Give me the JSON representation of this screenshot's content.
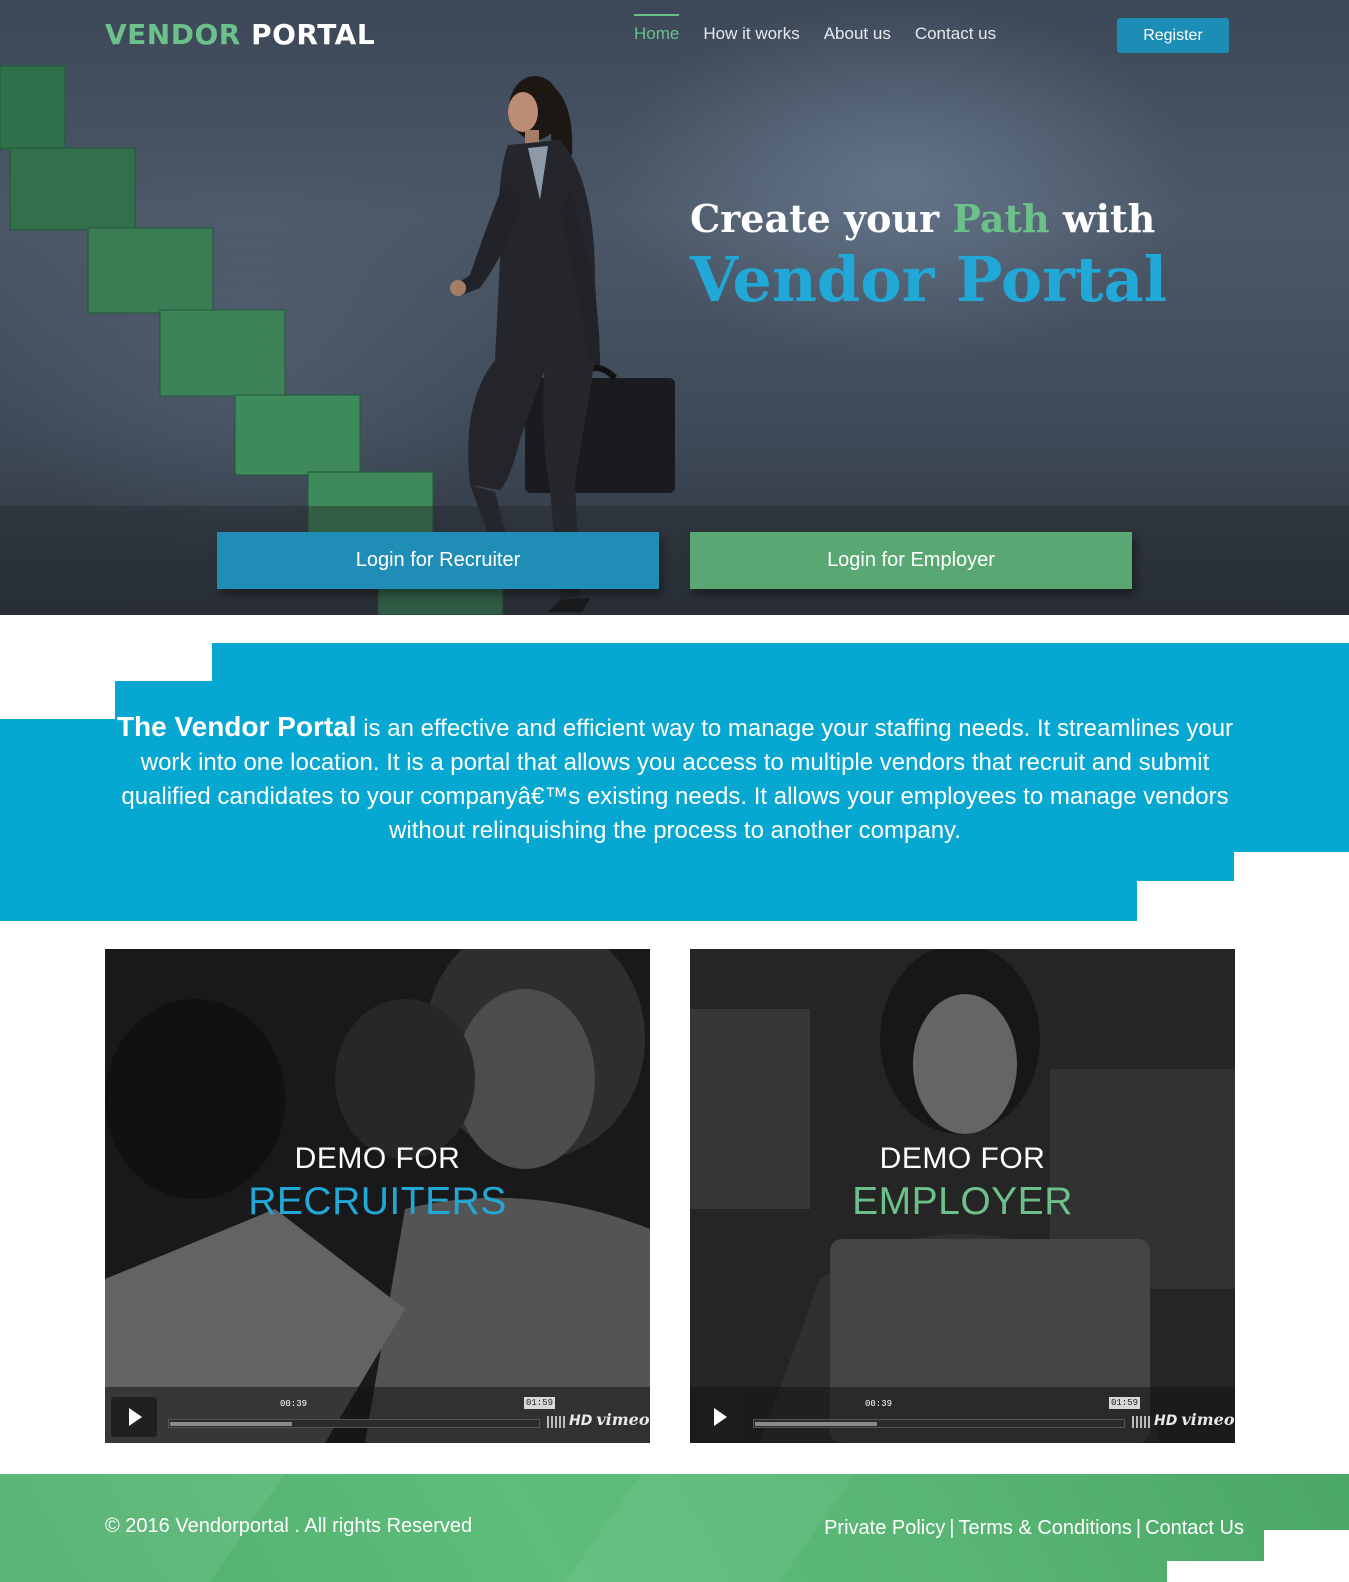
{
  "header": {
    "logo_part1": "VENDOR",
    "logo_part2": "PORTAL",
    "nav": [
      {
        "label": "Home",
        "active": true
      },
      {
        "label": "How it works",
        "active": false
      },
      {
        "label": "About us",
        "active": false
      },
      {
        "label": "Contact us",
        "active": false
      }
    ],
    "register_label": "Register"
  },
  "hero": {
    "headline_pre": "Create your ",
    "headline_highlight": "Path",
    "headline_post": " with",
    "headline_brand": "Vendor Portal",
    "login_recruiter_label": "Login for Recruiter",
    "login_employer_label": "Login for Employer"
  },
  "about": {
    "brand": "The Vendor Portal",
    "text": " is an effective and efficient way to manage your staffing needs. It streamlines your work into one location. It is a portal that allows you access to multiple vendors that recruit and submit qualified candidates to your companyâ€™s existing needs. It allows your employees to manage vendors without relinquishing the process to another company."
  },
  "demos": {
    "recruiters": {
      "title_line1": "DEMO FOR",
      "title_line2": "RECRUITERS",
      "time_current": "00:39",
      "time_total": "01:59",
      "progress": 0.33,
      "hd": "HD",
      "provider": "vimeo"
    },
    "employer": {
      "title_line1": "DEMO FOR",
      "title_line2": "EMPLOYER",
      "time_current": "00:39",
      "time_total": "01:59",
      "progress": 0.33,
      "hd": "HD",
      "provider": "vimeo"
    }
  },
  "footer": {
    "copyright": "© 2016 Vendorportal . All rights Reserved",
    "links": [
      "Private Policy",
      "Terms & Conditions",
      "Contact Us"
    ],
    "separator": "|"
  },
  "colors": {
    "brand_blue": "#1f8db5",
    "accent_blue": "#21a8d6",
    "brand_green": "#6cc08a",
    "band_blue": "#06a7d1",
    "footer_green": "#58b574"
  }
}
